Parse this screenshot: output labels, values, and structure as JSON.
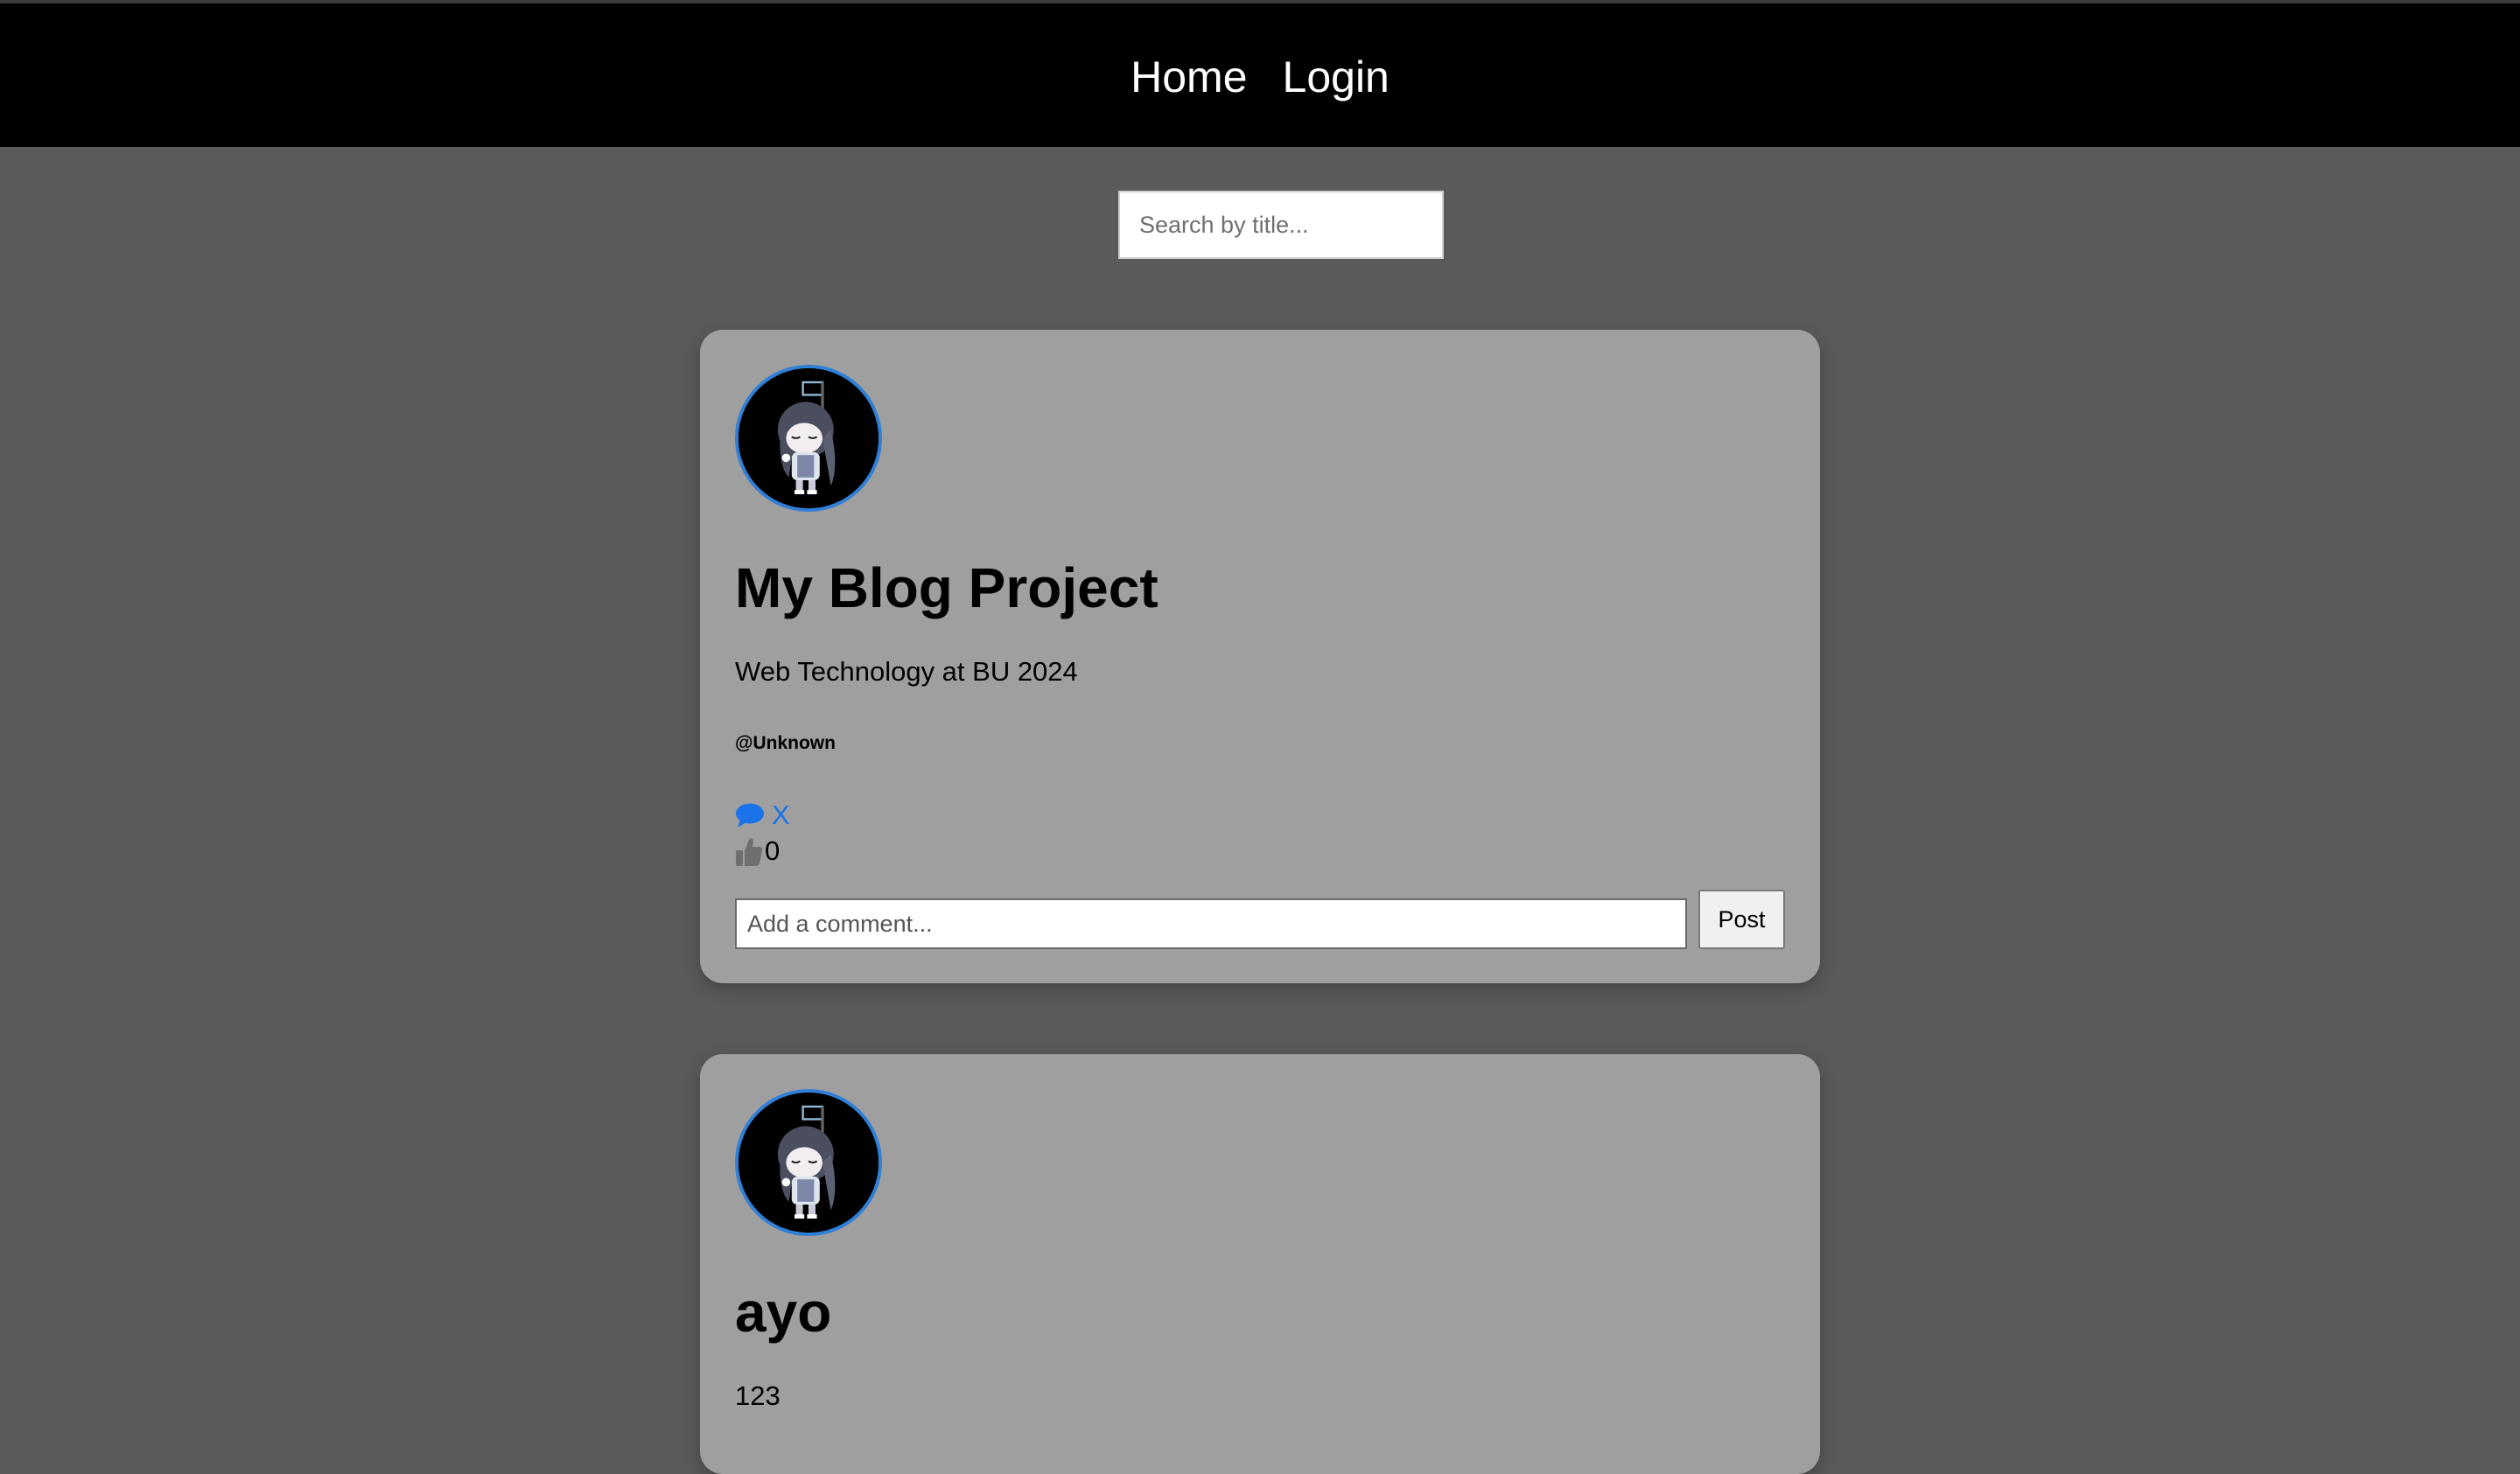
{
  "nav": {
    "home_label": "Home",
    "login_label": "Login"
  },
  "search": {
    "placeholder": "Search by title...",
    "value": ""
  },
  "posts": [
    {
      "title": "My Blog Project",
      "body": "Web Technology at BU 2024",
      "author": "@Unknown",
      "comment_toggle_label": "X",
      "likes": "0",
      "comment_placeholder": "Add a comment...",
      "post_button_label": "Post"
    },
    {
      "title": "ayo",
      "body": "123"
    }
  ],
  "colors": {
    "page_background": "#5a5a5a",
    "navbar_background": "#000000",
    "card_background": "#9f9f9f",
    "accent_blue": "#1a73e8",
    "avatar_border": "#2f7fd6"
  },
  "icons": {
    "avatar": "anime-character-avatar",
    "comment": "speech-bubble-icon",
    "like": "thumbs-up-icon"
  }
}
